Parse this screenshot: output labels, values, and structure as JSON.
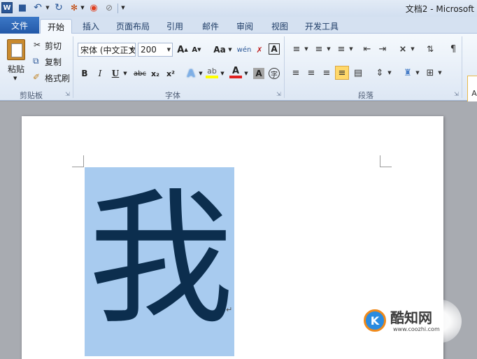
{
  "app": {
    "logo_letter": "W",
    "doc_title": "文档2 - Microsoft"
  },
  "quick_access": {
    "icons": [
      "word-logo",
      "save-icon",
      "undo-icon",
      "redo-icon",
      "format-painter-icon",
      "color-icon",
      "clear-icon",
      "customize-icon"
    ]
  },
  "tabs": {
    "file": "文件",
    "home": "开始",
    "insert": "插入",
    "layout": "页面布局",
    "references": "引用",
    "mailings": "邮件",
    "review": "审阅",
    "view": "视图",
    "developer": "开发工具"
  },
  "clipboard": {
    "paste": "粘贴",
    "cut": "剪切",
    "copy": "复制",
    "format_painter": "格式刷",
    "group": "剪贴板"
  },
  "font": {
    "name": "宋体 (中文正文)",
    "size": "200",
    "group": "字体",
    "grow": "A",
    "shrink": "A",
    "case": "Aa",
    "phonetic": "wén",
    "border_char": "A",
    "bold": "B",
    "italic": "I",
    "underline": "U",
    "strike": "abc",
    "sub": "x₂",
    "sup": "x²",
    "effect": "A",
    "highlight": "ab",
    "font_color": "A",
    "shading": "A",
    "enclose": "字"
  },
  "paragraph": {
    "group": "段落"
  },
  "styles": {
    "preview": "A"
  },
  "document": {
    "content": "我",
    "paragraph_mark": "↵"
  },
  "watermark": {
    "logo": "K",
    "name": "酷知网",
    "url": "www.coozhi.com"
  },
  "colors": {
    "accent": "#2b5797",
    "selection": "#a8cbef",
    "highlight": "#ffff00",
    "font_color": "#e02020",
    "justify_active": "#ffd86a"
  }
}
